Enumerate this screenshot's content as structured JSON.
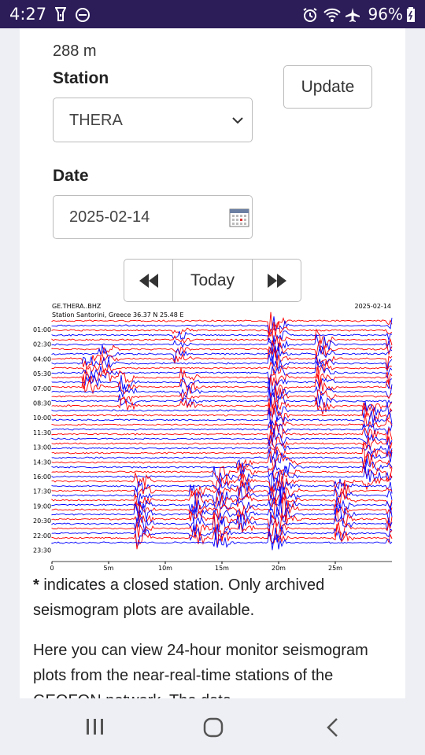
{
  "status_bar": {
    "time": "4:27",
    "battery_percent": "96%",
    "icons": [
      "flashlight-icon",
      "do-not-disturb-icon",
      "alarm-icon",
      "wifi-icon",
      "airplane-mode-icon",
      "battery-icon"
    ]
  },
  "form": {
    "cut_off_text": "288 m",
    "station_label": "Station",
    "station_value": "THERA",
    "update_label": "Update",
    "date_label": "Date",
    "date_value": "2025-02-14",
    "today_label": "Today"
  },
  "seismogram": {
    "channel": "GE.THERA..BHZ",
    "station_line": "Station Santorini, Greece  36.37 N 25.48 E",
    "date": "2025-02-14",
    "row_labels": [
      "01:00",
      "02:30",
      "04:00",
      "05:30",
      "07:00",
      "08:30",
      "10:00",
      "11:30",
      "13:00",
      "14:30",
      "16:00",
      "17:30",
      "19:00",
      "20:30",
      "22:00",
      "23:30"
    ],
    "x_ticks": [
      "0",
      "5m",
      "10m",
      "15m",
      "20m",
      "25m"
    ],
    "colors": {
      "red": "#ff0000",
      "blue": "#0000ff"
    }
  },
  "content": {
    "note_marker": "*",
    "note_text": " indicates a closed station. Only archived seismogram plots are available.",
    "intro_text": "Here you can view 24-hour monitor seismogram plots from the near-real-time stations of the GEOFON network. The data"
  },
  "nav_bar": {
    "buttons": [
      "recent-apps-button",
      "home-button",
      "back-button"
    ]
  }
}
